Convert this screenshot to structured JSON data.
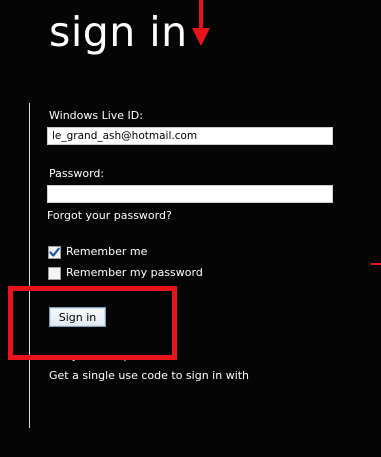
{
  "page": {
    "title": "sign in"
  },
  "form": {
    "id_label": "Windows Live ID:",
    "id_value": "le_grand_ash@hotmail.com",
    "password_label": "Password:",
    "password_value": "",
    "forgot_link": "Forgot your password?",
    "remember_me_label": "Remember me",
    "remember_me_checked": true,
    "remember_password_label": "Remember my password",
    "remember_password_checked": false,
    "signin_button": "Sign in",
    "not_your_computer_link": "Not your computer?",
    "single_use_code_link": "Get a single use code to sign in with"
  },
  "colors": {
    "background": "#050505",
    "annotation": "#e8141c",
    "text": "#ffffff"
  },
  "icons": {
    "annotation_arrow": "arrow-down-icon",
    "checkbox_mark": "checkmark-icon"
  }
}
